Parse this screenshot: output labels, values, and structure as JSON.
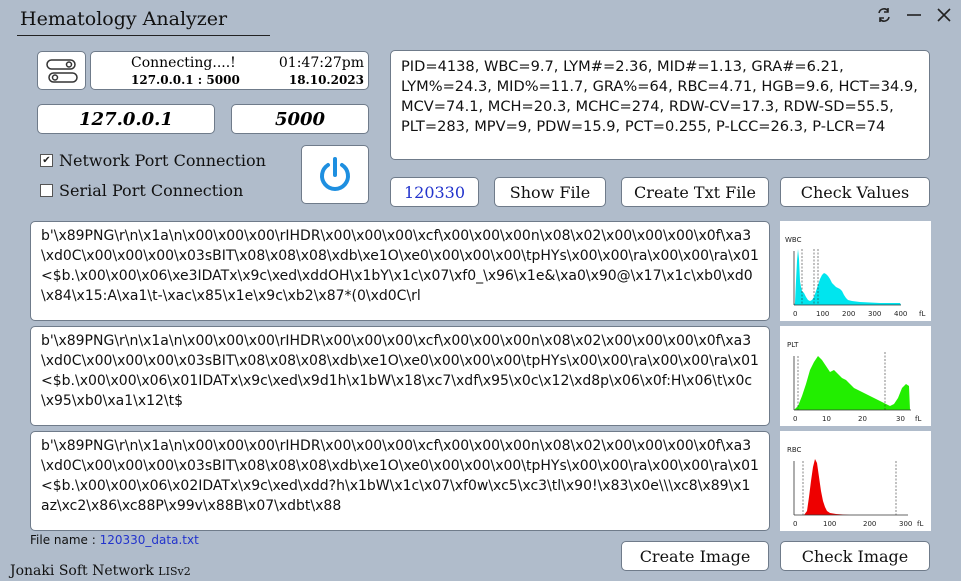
{
  "window": {
    "title": "Hematology Analyzer"
  },
  "status": {
    "connection": "Connecting....!",
    "time": "01:47:27pm",
    "address": "127.0.0.1 : 5000",
    "date": "18.10.2023"
  },
  "ip": "127.0.0.1",
  "port": "5000",
  "options": {
    "network": "Network Port Connection",
    "network_checked": true,
    "serial": "Serial Port Connection",
    "serial_checked": false
  },
  "results": {
    "text": "PID=4138, WBC=9.7, LYM#=2.36, MID#=1.13, GRA#=6.21, LYM%=24.3, MID%=11.7, GRA%=64, RBC=4.71, HGB=9.6, HCT=34.9, MCV=74.1, MCH=20.3, MCHC=274, RDW-CV=17.3, RDW-SD=55.5, PLT=283, MPV=9, PDW=15.9, PCT=0.255, P-LCC=26.3, P-LCR=74"
  },
  "toolbar": {
    "pid": "120330",
    "show_file": "Show File",
    "create_txt": "Create Txt File",
    "check_values": "Check Values"
  },
  "raw": [
    "b'\\x89PNG\\r\\n\\x1a\\n\\x00\\x00\\x00\\rIHDR\\x00\\x00\\x00\\xcf\\x00\\x00\\x00n\\x08\\x02\\x00\\x00\\x00\\x0f\\xa3\\xd0C\\x00\\x00\\x00\\x03sBIT\\x08\\x08\\x08\\xdb\\xe1O\\xe0\\x00\\x00\\x00\\tpHYs\\x00\\x00\\ra\\x00\\x00\\ra\\x01<$b.\\x00\\x00\\x06\\xe3IDATx\\x9c\\xed\\xddOH\\x1bY\\x1c\\x07\\xf0_\\x96\\x1e&\\xa0\\x90@\\x17\\x1c\\xb0\\xd0\\x84\\x15:A\\xa1\\t-\\xac\\x85\\x1e\\x9c\\xb2\\x87*(0\\xd0C\\rl",
    "b'\\x89PNG\\r\\n\\x1a\\n\\x00\\x00\\x00\\rIHDR\\x00\\x00\\x00\\xcf\\x00\\x00\\x00n\\x08\\x02\\x00\\x00\\x00\\x0f\\xa3\\xd0C\\x00\\x00\\x00\\x03sBIT\\x08\\x08\\x08\\xdb\\xe1O\\xe0\\x00\\x00\\x00\\tpHYs\\x00\\x00\\ra\\x00\\x00\\ra\\x01<$b.\\x00\\x00\\x06\\x01IDATx\\x9c\\xed\\x9d1h\\x1bW\\x18\\xc7\\xdf\\x95\\x0c\\x12\\xd8p\\x06\\x0f:H\\x06\\t\\x0c\\x95\\xb0\\xa1\\x12\\t$",
    "b'\\x89PNG\\r\\n\\x1a\\n\\x00\\x00\\x00\\rIHDR\\x00\\x00\\x00\\xcf\\x00\\x00\\x00n\\x08\\x02\\x00\\x00\\x00\\x0f\\xa3\\xd0C\\x00\\x00\\x00\\x03sBIT\\x08\\x08\\x08\\xdb\\xe1O\\xe0\\x00\\x00\\x00\\tpHYs\\x00\\x00\\ra\\x00\\x00\\ra\\x01<$b.\\x00\\x00\\x06\\x02IDATx\\x9c\\xed\\xdd?h\\x1bW\\x1c\\x07\\xf0w\\xc5\\xc3\\tl\\x90!\\x83\\x0e\\\\\\xc8\\x89\\x1az\\xc2\\x86\\xc88P\\x99v\\x88B\\x07\\xdbt\\x88"
  ],
  "graphs": [
    {
      "label": "WBC",
      "ticks": [
        "0",
        "100",
        "200",
        "300",
        "400"
      ],
      "unit": "fL",
      "color": "#00e5ee"
    },
    {
      "label": "PLT",
      "ticks": [
        "0",
        "10",
        "20",
        "30"
      ],
      "unit": "fL",
      "color": "#22ee00"
    },
    {
      "label": "RBC",
      "ticks": [
        "0",
        "100",
        "200",
        "300"
      ],
      "unit": "fL",
      "color": "#ee0000"
    }
  ],
  "file": {
    "label": "File name :",
    "value": "120330_data.txt"
  },
  "bottom": {
    "create_image": "Create Image",
    "check_image": "Check Image"
  },
  "footer": {
    "brand": "Jonaki Soft Network",
    "version": "LISv2"
  }
}
